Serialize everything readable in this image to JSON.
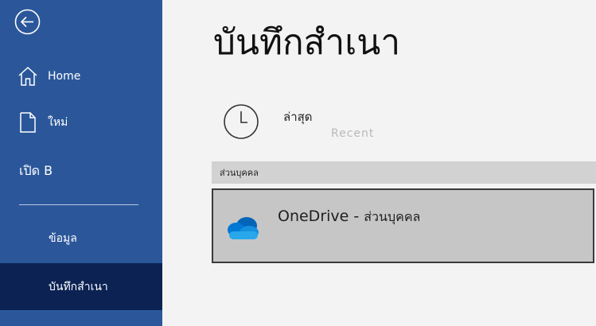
{
  "sidebar": {
    "items": [
      {
        "label": "Home",
        "icon": "home-icon"
      },
      {
        "label": "ใหม่",
        "icon": "new-document-icon"
      },
      {
        "label": "เปิด B",
        "icon": ""
      },
      {
        "label": "ข้อมูล",
        "icon": ""
      },
      {
        "label": "บันทึกสำเนา",
        "icon": "",
        "selected": true
      }
    ]
  },
  "main": {
    "title": "บันทึกสำเนา",
    "recent": {
      "label": "ล่าสุด",
      "ghost_text": "Recent"
    },
    "section": {
      "label": "ส่วนบุคคล"
    },
    "onedrive": {
      "label": "OneDrive - ",
      "sub_label": "ส่วนบุคคล"
    }
  },
  "colors": {
    "sidebar_bg": "#2b579a",
    "selected_bg": "#0b2253",
    "main_bg": "#f3f3f3",
    "section_bg": "#d2d2d2",
    "tile_bg": "#c6c6c6",
    "tile_border": "#3b3b3b"
  }
}
